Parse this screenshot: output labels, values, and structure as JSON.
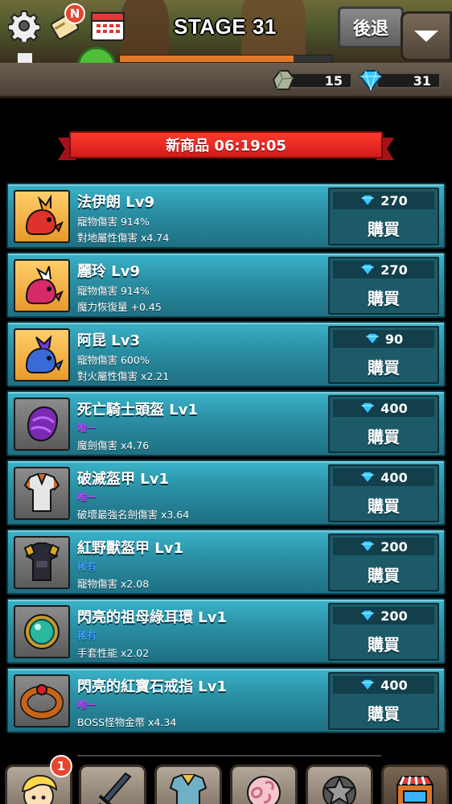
{
  "hud": {
    "stage_title": "STAGE 31",
    "back_label": "後退",
    "notification_badge": "N",
    "stage_progress": 0.82
  },
  "resources": {
    "stones": "15",
    "gems": "31"
  },
  "shop": {
    "banner": "新商品 06:19:05",
    "buy_label": "購買",
    "items": [
      {
        "name": "法伊朗 Lv9",
        "rarity": "",
        "stat1": "寵物傷害 914%",
        "stat2": "對地屬性傷害 x4.74",
        "price": "270",
        "icon": "red-dragon-pet-icon",
        "kind": "pet"
      },
      {
        "name": "麗玲 Lv9",
        "rarity": "",
        "stat1": "寵物傷害 914%",
        "stat2": "魔力恢復量 +0.45",
        "price": "270",
        "icon": "pink-dragon-pet-icon",
        "kind": "pet"
      },
      {
        "name": "阿昆 Lv3",
        "rarity": "",
        "stat1": "寵物傷害 600%",
        "stat2": "對火屬性傷害 x2.21",
        "price": "90",
        "icon": "blue-dragon-pet-icon",
        "kind": "pet"
      },
      {
        "name": "死亡騎士頭盔  Lv1",
        "rarity": "唯一",
        "stat1": "",
        "stat2": "魔劍傷害 x4.76",
        "price": "400",
        "icon": "purple-helmet-icon",
        "kind": "gear"
      },
      {
        "name": "破滅盔甲  Lv1",
        "rarity": "唯一",
        "stat1": "",
        "stat2": "破壞最強名劍傷害 x3.64",
        "price": "400",
        "icon": "silver-armor-icon",
        "kind": "gear"
      },
      {
        "name": "紅野獸盔甲  Lv1",
        "rarity": "稀有",
        "stat1": "",
        "stat2": "寵物傷害 x2.08",
        "price": "200",
        "icon": "dark-armor-icon",
        "kind": "gear"
      },
      {
        "name": "閃亮的祖母綠耳環  Lv1",
        "rarity": "稀有",
        "stat1": "",
        "stat2": "手套性能 x2.02",
        "price": "200",
        "icon": "emerald-earring-icon",
        "kind": "gear"
      },
      {
        "name": "閃亮的紅寶石戒指  Lv1",
        "rarity": "唯一",
        "stat1": "",
        "stat2": "BOSS怪物金幣 x4.34",
        "price": "400",
        "icon": "ruby-ring-icon",
        "kind": "gear"
      }
    ]
  },
  "nav": {
    "hero_badge": "1",
    "tabs": [
      "hero-tab",
      "weapon-tab",
      "armor-tab",
      "pet-egg-tab",
      "skill-tab",
      "shop-tab"
    ]
  }
}
